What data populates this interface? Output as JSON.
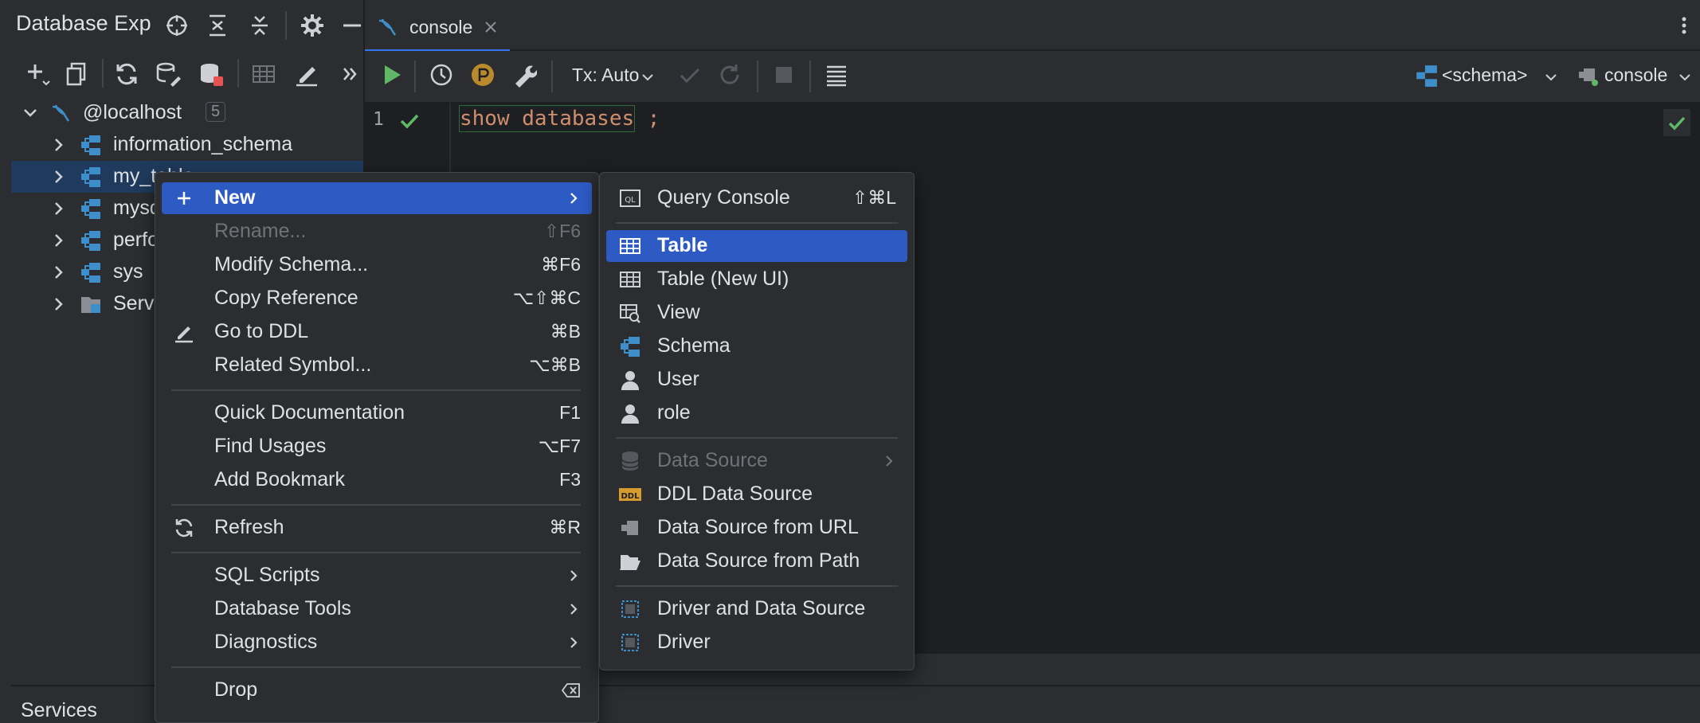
{
  "explorer": {
    "title": "Database Exp",
    "tree": [
      {
        "label": "@localhost",
        "count": "5"
      },
      {
        "label": "information_schema"
      },
      {
        "label": "my_table"
      },
      {
        "label": "mysql"
      },
      {
        "label": "performance_schema"
      },
      {
        "label": "sys"
      },
      {
        "label": "Server Objects"
      }
    ]
  },
  "editor": {
    "tab_label": "console",
    "tx_mode": "Tx: Auto",
    "schema_selector": "<schema>",
    "session_selector": "console",
    "line_number": "1",
    "code_keyword": "show databases",
    "code_terminator": " ;"
  },
  "context_menu": {
    "items": [
      {
        "label": "New",
        "shortcut": ""
      },
      {
        "label": "Rename...",
        "shortcut": "⇧F6"
      },
      {
        "label": "Modify Schema...",
        "shortcut": "⌘F6"
      },
      {
        "label": "Copy Reference",
        "shortcut": "⌥⇧⌘C"
      },
      {
        "label": "Go to DDL",
        "shortcut": "⌘B"
      },
      {
        "label": "Related Symbol...",
        "shortcut": "⌥⌘B"
      },
      {
        "label": "Quick Documentation",
        "shortcut": "F1"
      },
      {
        "label": "Find Usages",
        "shortcut": "⌥F7"
      },
      {
        "label": "Add Bookmark",
        "shortcut": "F3"
      },
      {
        "label": "Refresh",
        "shortcut": "⌘R"
      },
      {
        "label": "SQL Scripts",
        "shortcut": ""
      },
      {
        "label": "Database Tools",
        "shortcut": ""
      },
      {
        "label": "Diagnostics",
        "shortcut": ""
      },
      {
        "label": "Drop",
        "shortcut": ""
      }
    ]
  },
  "submenu": {
    "items": [
      {
        "label": "Query Console",
        "shortcut": "⇧⌘L"
      },
      {
        "label": "Table"
      },
      {
        "label": "Table (New UI)"
      },
      {
        "label": "View"
      },
      {
        "label": "Schema"
      },
      {
        "label": "User"
      },
      {
        "label": "role"
      },
      {
        "label": "Data Source"
      },
      {
        "label": "DDL Data Source"
      },
      {
        "label": "Data Source from URL"
      },
      {
        "label": "Data Source from Path"
      },
      {
        "label": "Driver and Data Source"
      },
      {
        "label": "Driver"
      }
    ],
    "query_console_icon_text": "QL",
    "ddl_icon_text": "DDL"
  },
  "services": {
    "label": "Services"
  },
  "colors": {
    "accent": "#3574f0",
    "highlight": "#2e5ac4",
    "keyword_orange": "#cf8e6d",
    "success_green": "#5fb865",
    "schema_blue": "#3e8ec9"
  }
}
